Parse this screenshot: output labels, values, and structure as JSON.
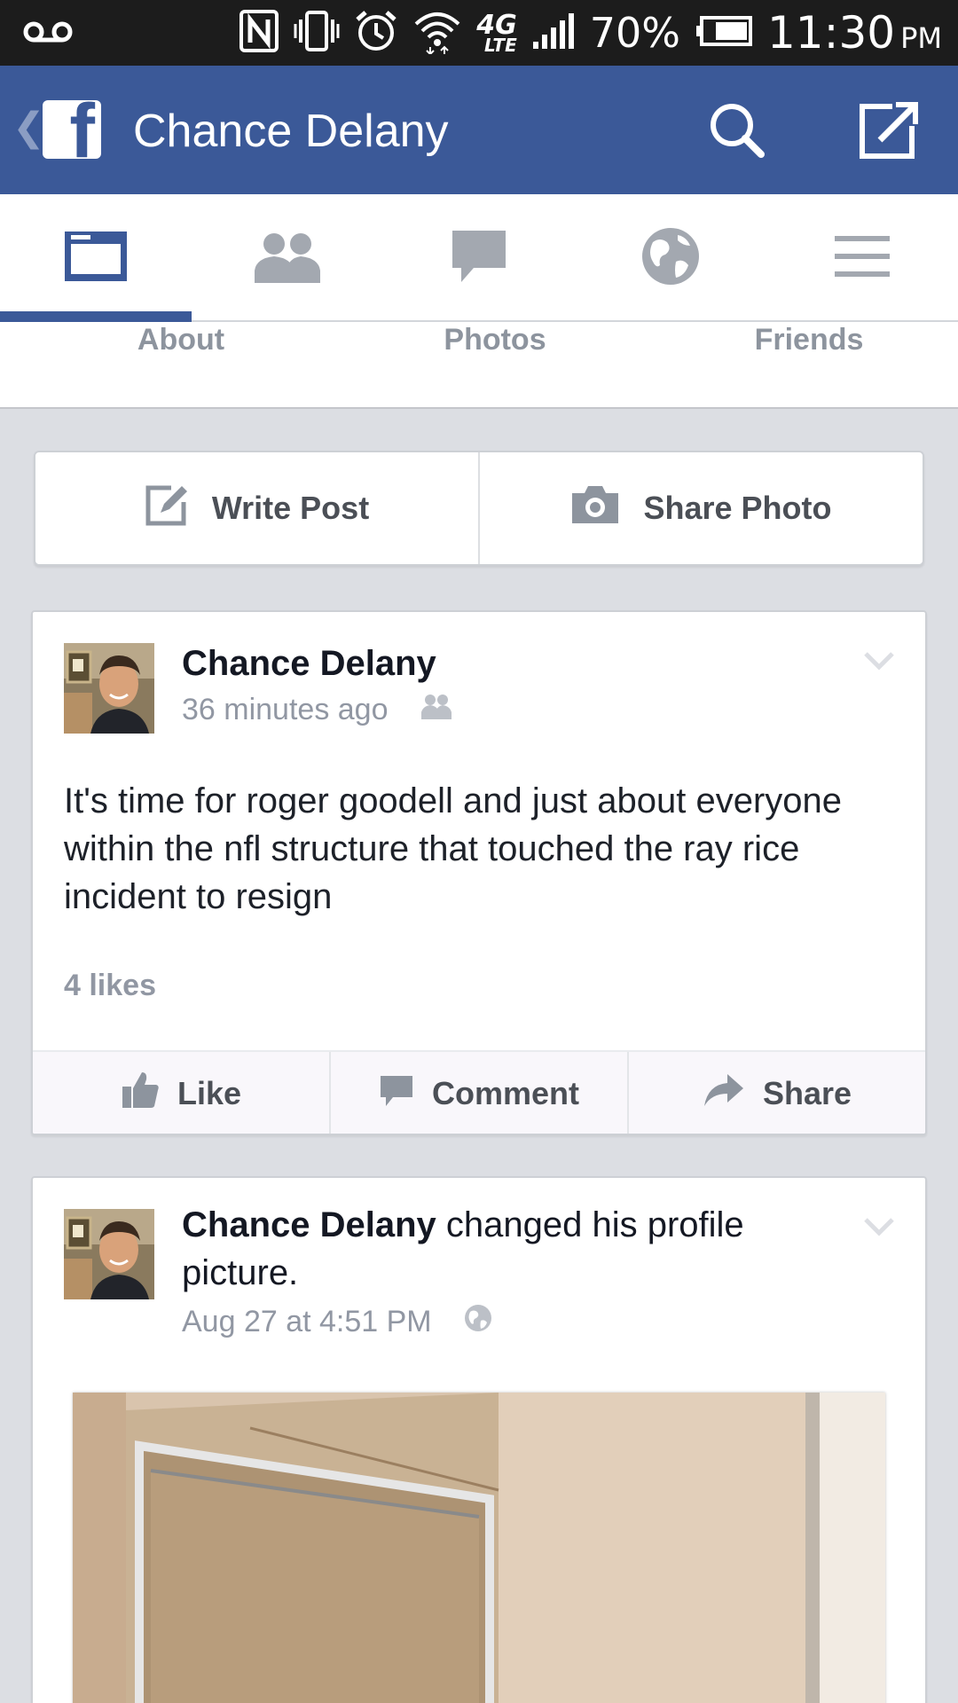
{
  "status_bar": {
    "battery": "70%",
    "time": "11:30",
    "ampm": "PM",
    "network": "4G",
    "network_sub": "LTE",
    "icons": [
      "voicemail-icon",
      "nfc-icon",
      "vibrate-icon",
      "alarm-icon",
      "wifi-icon",
      "signal-icon",
      "battery-icon"
    ]
  },
  "app_bar": {
    "title": "Chance Delany",
    "logo_letter": "f",
    "back_glyph": "❮",
    "brand_color": "#3b5998"
  },
  "tabs": [
    {
      "icon": "news-feed-icon",
      "active": true
    },
    {
      "icon": "friend-requests-icon",
      "active": false
    },
    {
      "icon": "messages-icon",
      "active": false
    },
    {
      "icon": "notifications-globe-icon",
      "active": false
    },
    {
      "icon": "menu-icon",
      "active": false
    }
  ],
  "profile_nav": {
    "about": "About",
    "photos": "Photos",
    "friends": "Friends"
  },
  "composer": {
    "write_post": "Write Post",
    "share_photo": "Share Photo"
  },
  "stories": [
    {
      "author": "Chance Delany",
      "time": "36 minutes ago",
      "audience_icon": "friends-icon",
      "text": "It's time for roger goodell and just about everyone within the nfl structure that touched the ray rice incident to resign",
      "likes": "4 likes",
      "actions": {
        "like": "Like",
        "comment": "Comment",
        "share": "Share"
      }
    },
    {
      "author": "Chance Delany",
      "action_text": " changed his profile picture.",
      "time": "Aug 27 at 4:51 PM",
      "audience_icon": "public-globe-icon"
    }
  ]
}
